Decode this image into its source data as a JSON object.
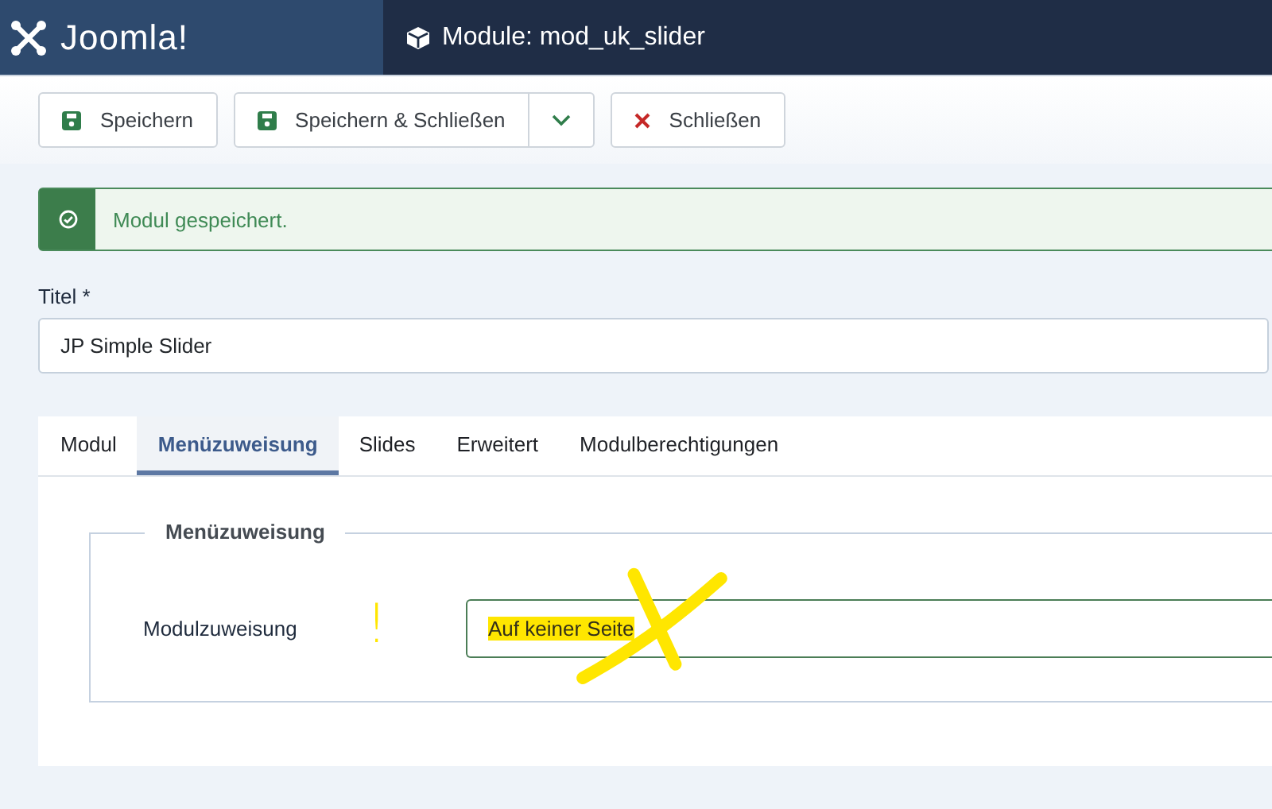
{
  "header": {
    "logo": "Joomla!",
    "title": "Module: mod_uk_slider"
  },
  "toolbar": {
    "buttons": [
      {
        "kind": "save",
        "label": "Speichern"
      },
      {
        "kind": "save-split",
        "label": "Speichern & Schließen"
      },
      {
        "kind": "close",
        "label": "Schließen"
      }
    ]
  },
  "alert": {
    "message": "Modul gespeichert."
  },
  "title_field": {
    "label": "Titel *",
    "value": "JP Simple Slider"
  },
  "tabs": [
    {
      "label": "Modul",
      "selected": false
    },
    {
      "label": "Menüzuweisung",
      "selected": true
    },
    {
      "label": "Slides",
      "selected": false
    },
    {
      "label": "Erweitert",
      "selected": false
    },
    {
      "label": "Modulberechtigungen",
      "selected": false
    }
  ],
  "fieldset": {
    "legend": "Menüzuweisung",
    "label": "Modulzuweisung",
    "value": "Auf keiner Seite"
  },
  "annotation": {
    "mark": "!"
  }
}
